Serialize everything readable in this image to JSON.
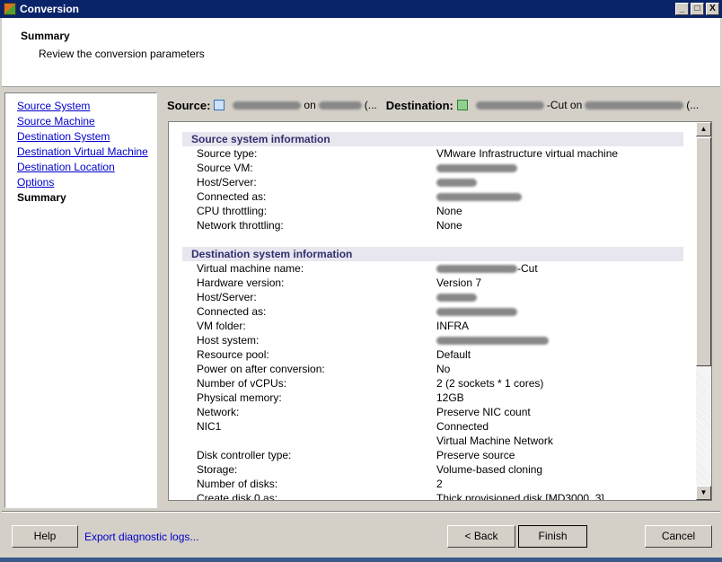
{
  "window": {
    "title": "Conversion",
    "controls": [
      "_",
      "□",
      "X"
    ]
  },
  "header": {
    "title": "Summary",
    "subtitle": "Review the conversion parameters"
  },
  "nav": {
    "items": [
      "Source System",
      "Source Machine",
      "Destination System",
      "Destination Virtual Machine",
      "Destination Location",
      "Options"
    ],
    "current": "Summary"
  },
  "srcbar": {
    "source_label": "Source:",
    "on": "on",
    "ellipsis": "(...",
    "destination_label": "Destination:",
    "dest_suffix": "-Cut on",
    "dest_ellipsis": "(..."
  },
  "source_section": {
    "title": "Source system information",
    "rows": [
      {
        "label": "Source type:",
        "value": "VMware Infrastructure virtual machine"
      },
      {
        "label": "Source VM:",
        "value": ""
      },
      {
        "label": "Host/Server:",
        "value": ""
      },
      {
        "label": "Connected as:",
        "value": ""
      },
      {
        "label": "CPU throttling:",
        "value": "None"
      },
      {
        "label": "Network throttling:",
        "value": "None"
      }
    ]
  },
  "dest_section": {
    "title": "Destination system information",
    "rows": [
      {
        "label": "Virtual machine name:",
        "value": "-Cut"
      },
      {
        "label": "Hardware version:",
        "value": "Version 7"
      },
      {
        "label": "Host/Server:",
        "value": ""
      },
      {
        "label": "Connected as:",
        "value": ""
      },
      {
        "label": "VM folder:",
        "value": "INFRA"
      },
      {
        "label": "Host system:",
        "value": ""
      },
      {
        "label": "Resource pool:",
        "value": "Default"
      },
      {
        "label": "Power on after conversion:",
        "value": "No"
      },
      {
        "label": "Number of vCPUs:",
        "value": "2 (2 sockets * 1 cores)"
      },
      {
        "label": "Physical memory:",
        "value": "12GB"
      },
      {
        "label": "Network:",
        "value": "Preserve NIC count"
      },
      {
        "label": "NIC1",
        "value": "Connected"
      },
      {
        "label": "",
        "value": "Virtual Machine Network"
      },
      {
        "label": "Disk controller type:",
        "value": "Preserve source"
      },
      {
        "label": "Storage:",
        "value": "Volume-based cloning"
      },
      {
        "label": "Number of disks:",
        "value": "2"
      },
      {
        "label": "Create disk 0 as:",
        "value": "Thick provisioned disk [MD3000_3]"
      }
    ]
  },
  "footer": {
    "help": "Help",
    "export": "Export diagnostic logs...",
    "back": "< Back",
    "finish": "Finish",
    "cancel": "Cancel"
  }
}
